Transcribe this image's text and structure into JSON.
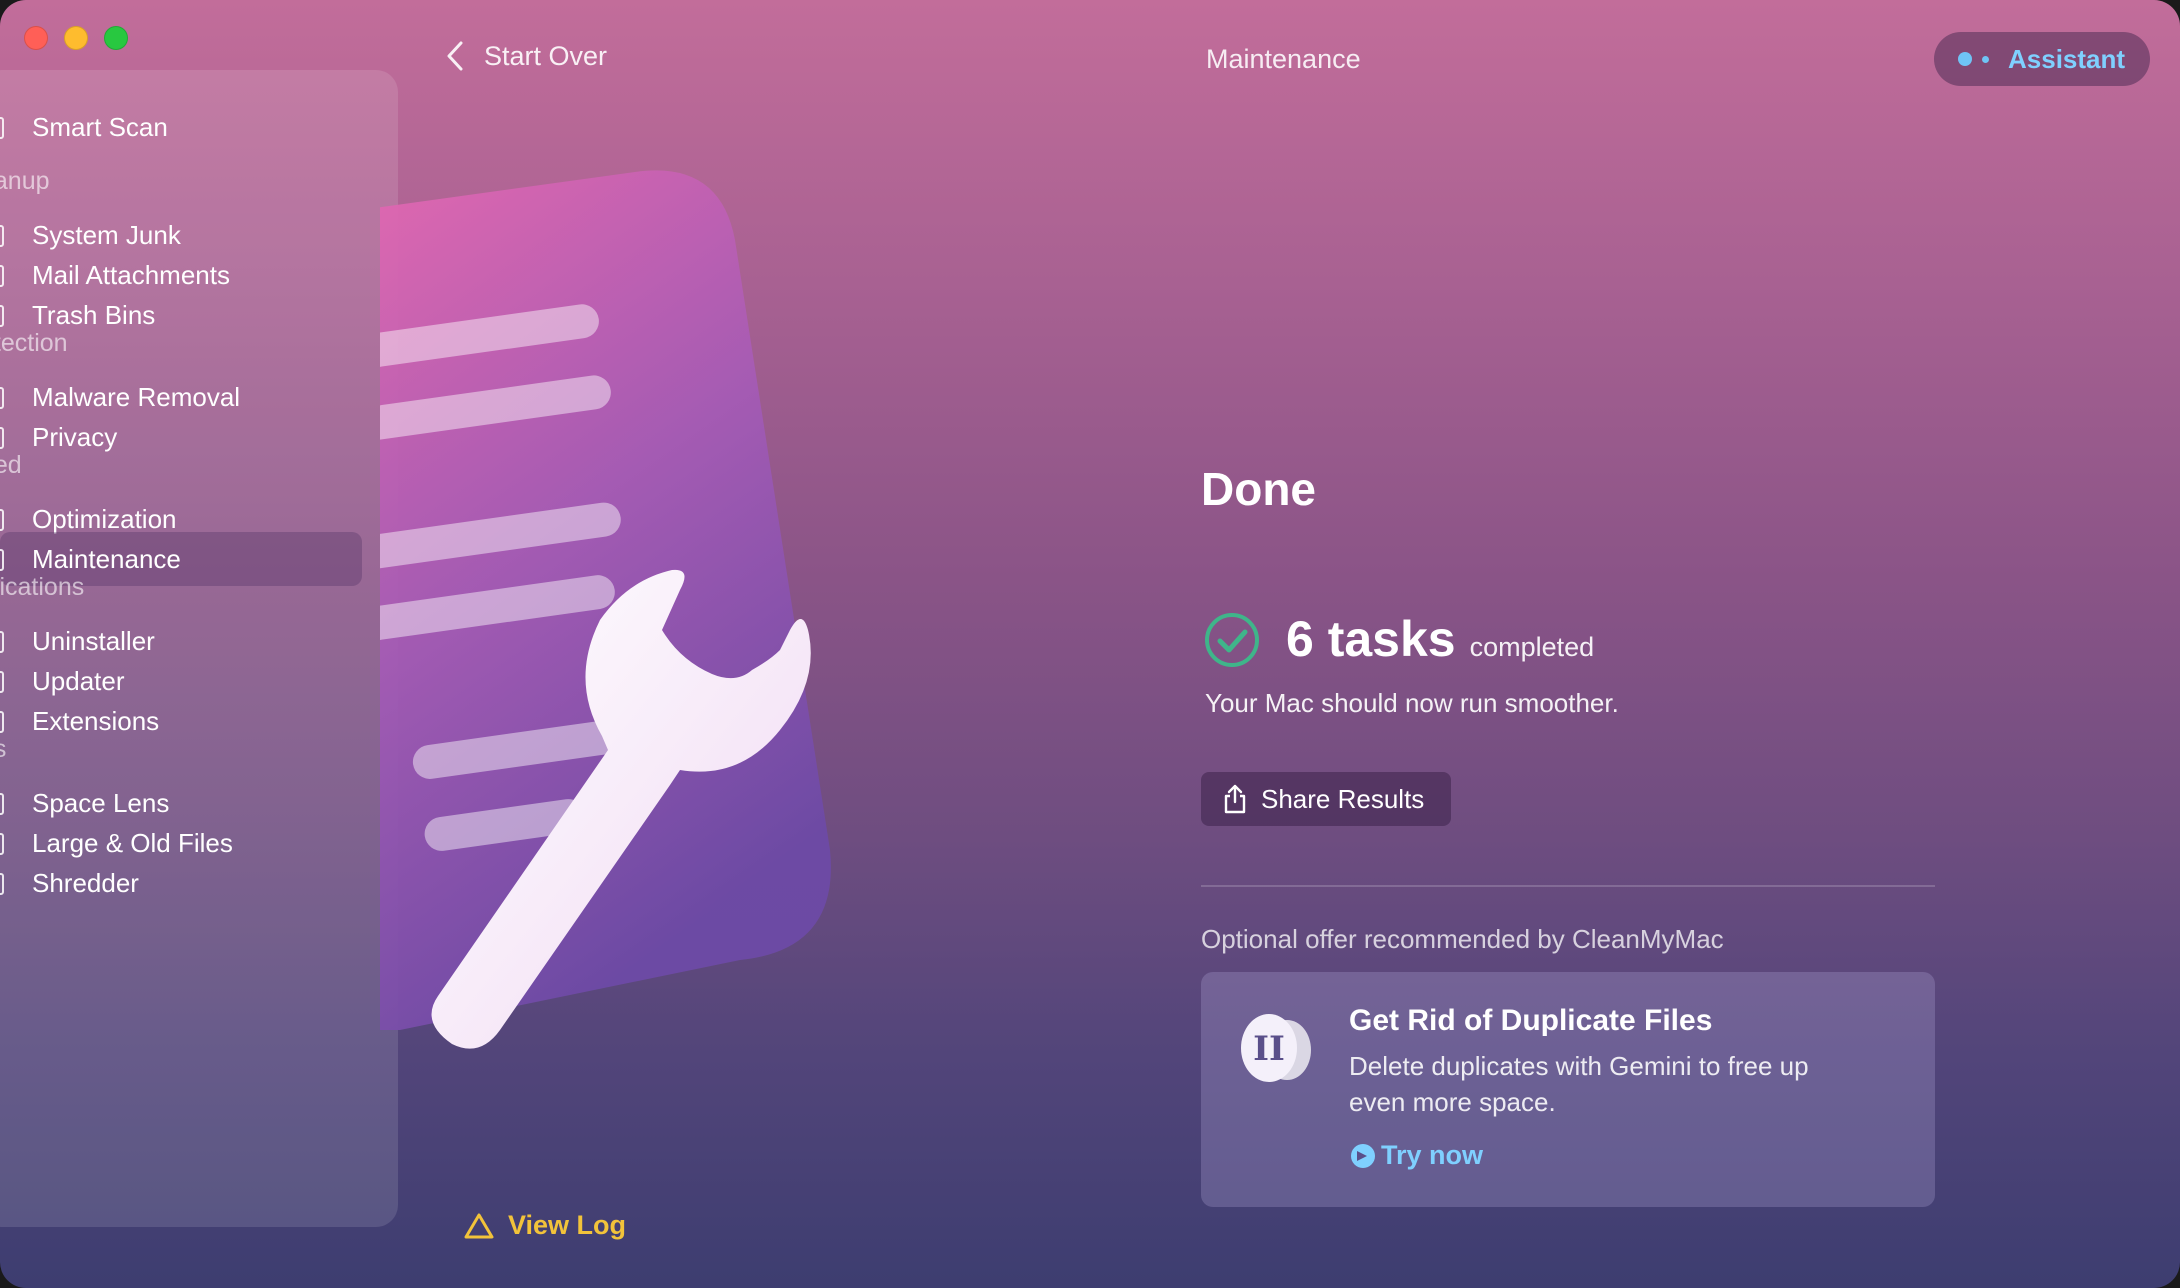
{
  "window": {
    "title": "Maintenance"
  },
  "topbar": {
    "back_label": "Start Over",
    "assistant_label": "Assistant"
  },
  "sidebar": {
    "items": [
      {
        "label": "Smart Scan",
        "type": "item"
      },
      {
        "label": "eanup",
        "type": "heading"
      },
      {
        "label": "System Junk",
        "type": "item"
      },
      {
        "label": "Mail Attachments",
        "type": "item"
      },
      {
        "label": "Trash Bins",
        "type": "item"
      },
      {
        "label": "otection",
        "type": "heading"
      },
      {
        "label": "Malware Removal",
        "type": "item"
      },
      {
        "label": "Privacy",
        "type": "item"
      },
      {
        "label": "eed",
        "type": "heading"
      },
      {
        "label": "Optimization",
        "type": "item"
      },
      {
        "label": "Maintenance",
        "type": "item",
        "active": true
      },
      {
        "label": "plications",
        "type": "heading"
      },
      {
        "label": "Uninstaller",
        "type": "item"
      },
      {
        "label": "Updater",
        "type": "item"
      },
      {
        "label": "Extensions",
        "type": "item"
      },
      {
        "label": "es",
        "type": "heading"
      },
      {
        "label": "Space Lens",
        "type": "item"
      },
      {
        "label": "Large & Old Files",
        "type": "item"
      },
      {
        "label": "Shredder",
        "type": "item"
      }
    ]
  },
  "result": {
    "heading": "Done",
    "count": "6 tasks",
    "completed_label": "completed",
    "subtitle": "Your Mac should now run smoother.",
    "share_label": "Share Results"
  },
  "offer": {
    "header": "Optional offer recommended by CleanMyMac",
    "title": "Get Rid of Duplicate Files",
    "description": "Delete duplicates with Gemini to free up even more space.",
    "cta": "Try now"
  },
  "footer": {
    "view_log_label": "View Log"
  },
  "colors": {
    "accent_blue": "#7fd0ff",
    "warning_yellow": "#f2c33a",
    "success_green": "#3fb58a"
  }
}
